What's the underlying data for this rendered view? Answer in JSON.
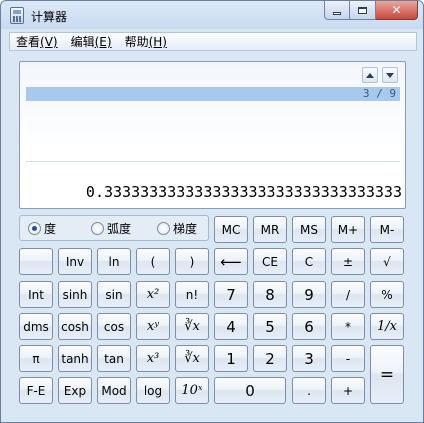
{
  "window": {
    "title": "计算器",
    "minimize_label": "",
    "maximize_label": "",
    "close_label": "✕"
  },
  "menubar": [
    {
      "label": "查看",
      "mnemonic": "(V)"
    },
    {
      "label": "编辑",
      "mnemonic": "(E)"
    },
    {
      "label": "帮助",
      "mnemonic": "(H)"
    }
  ],
  "display": {
    "history_expression": "3 / 9",
    "result": "0.333333333333333333333333333333333"
  },
  "angle_mode": {
    "options": [
      "度",
      "弧度",
      "梯度"
    ],
    "selected": "度"
  },
  "buttons": {
    "mc": "MC",
    "mr": "MR",
    "ms": "MS",
    "mplus": "M+",
    "mminus": "M-",
    "inv": "Inv",
    "ln": "ln",
    "lparen": "(",
    "rparen": ")",
    "backspace": "⟵",
    "ce": "CE",
    "c": "C",
    "plusminus": "±",
    "sqrt": "√",
    "int": "Int",
    "sinh": "sinh",
    "sin": "sin",
    "xsq": "x²",
    "fact": "n!",
    "n7": "7",
    "n8": "8",
    "n9": "9",
    "div": "/",
    "pct": "%",
    "dms": "dms",
    "cosh": "cosh",
    "cos": "cos",
    "xpowy": "xʸ",
    "yroot": "∛x",
    "n4": "4",
    "n5": "5",
    "n6": "6",
    "mul": "*",
    "recip": "1/x",
    "pi": "π",
    "tanh": "tanh",
    "tan": "tan",
    "xcube": "x³",
    "cuberoot": "∛x",
    "n1": "1",
    "n2": "2",
    "n3": "3",
    "sub": "-",
    "equals": "=",
    "fe": "F-E",
    "exp": "Exp",
    "mod": "Mod",
    "log": "log",
    "tenpow": "10ˣ",
    "n0": "0",
    "dot": ".",
    "add": "+"
  }
}
